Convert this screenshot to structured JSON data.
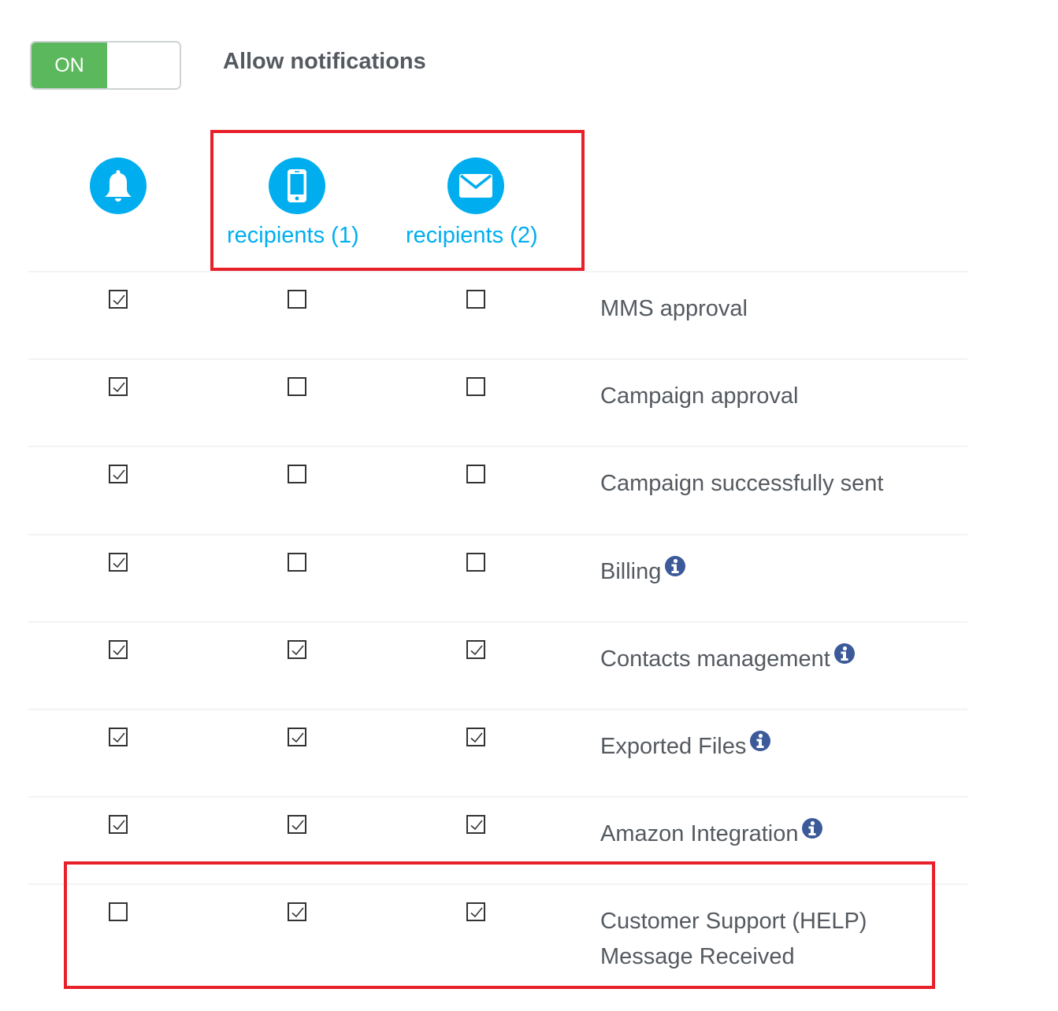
{
  "toggle": {
    "state_label": "ON",
    "is_on": true,
    "color_on": "#5cb85c"
  },
  "header": {
    "title": "Allow notifications"
  },
  "columns": [
    {
      "key": "in_app",
      "icon": "bell-icon",
      "label": ""
    },
    {
      "key": "sms",
      "icon": "mobile-phone-icon",
      "label": "recipients (1)"
    },
    {
      "key": "email",
      "icon": "envelope-icon",
      "label": "recipients (2)"
    }
  ],
  "colors": {
    "accent": "#00aeef",
    "info": "#3c5a99",
    "highlight": "#e8202a",
    "text": "#555a60"
  },
  "rows": [
    {
      "label": "MMS approval",
      "label_line2": "",
      "info": false,
      "checks": [
        true,
        false,
        false
      ]
    },
    {
      "label": "Campaign approval",
      "label_line2": "",
      "info": false,
      "checks": [
        true,
        false,
        false
      ]
    },
    {
      "label": "Campaign successfully sent",
      "label_line2": "",
      "info": false,
      "checks": [
        true,
        false,
        false
      ]
    },
    {
      "label": "Billing",
      "label_line2": "",
      "info": true,
      "checks": [
        true,
        false,
        false
      ]
    },
    {
      "label": "Contacts management",
      "label_line2": "",
      "info": true,
      "checks": [
        true,
        true,
        true
      ]
    },
    {
      "label": "Exported Files",
      "label_line2": "",
      "info": true,
      "checks": [
        true,
        true,
        true
      ]
    },
    {
      "label": "Amazon Integration",
      "label_line2": "",
      "info": true,
      "checks": [
        true,
        true,
        true
      ]
    },
    {
      "label": "Customer Support (HELP)",
      "label_line2": "Message Received",
      "info": false,
      "checks": [
        false,
        true,
        true
      ]
    }
  ]
}
